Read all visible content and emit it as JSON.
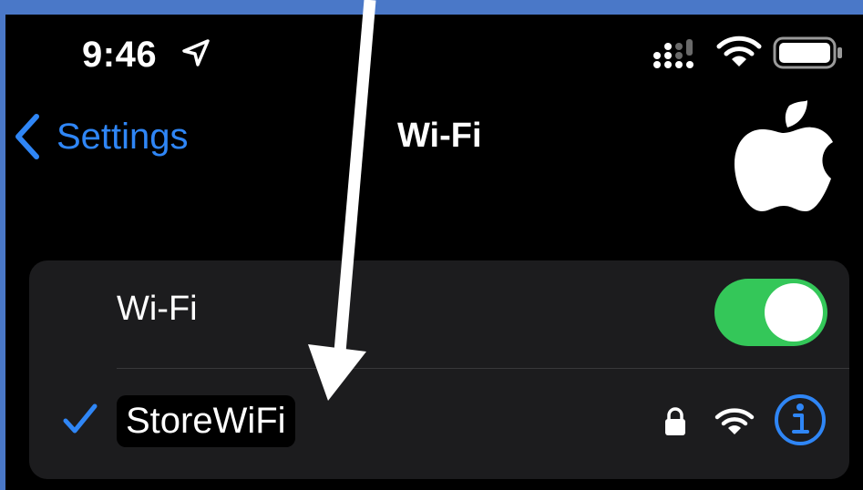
{
  "status_bar": {
    "time": "9:46",
    "icons": [
      "location-arrow-icon",
      "cellular-signal-icon",
      "wifi-icon",
      "battery-icon"
    ]
  },
  "nav": {
    "back_label": "Settings",
    "title": "Wi-Fi"
  },
  "wifi_toggle": {
    "label": "Wi-Fi",
    "state": "on"
  },
  "connected_network": {
    "name": "StoreWiFi",
    "secured": true,
    "icons": [
      "checkmark-icon",
      "lock-icon",
      "wifi-signal-icon",
      "info-icon"
    ]
  },
  "colors": {
    "accent": "#2f86f6",
    "toggle_on": "#34c759",
    "background": "#000000",
    "card": "#1c1c1e",
    "border_frame": "#4a78c8"
  }
}
